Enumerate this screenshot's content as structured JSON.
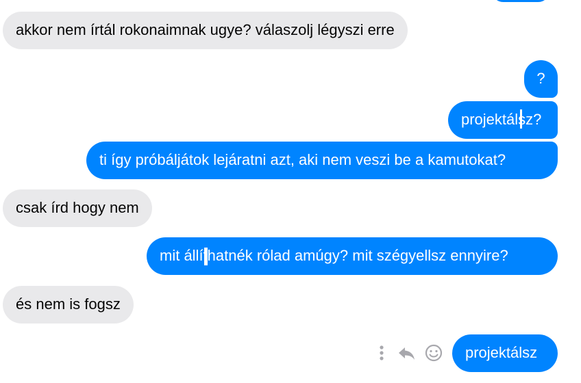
{
  "chat": {
    "messages": [
      {
        "side": "in",
        "text": "akkor nem írtál rokonaimnak ugye? válaszolj légyszi erre"
      },
      {
        "side": "out",
        "text": "?"
      },
      {
        "side": "out",
        "text": "projektálsz?"
      },
      {
        "side": "out",
        "text": "ti így próbáljátok lejáratni azt, aki nem veszi be a kamutokat?"
      },
      {
        "side": "in",
        "text": "csak írd hogy nem"
      },
      {
        "side": "out",
        "text": "mit állíthatnék rólad amúgy? mit szégyellsz ennyire?"
      },
      {
        "side": "in",
        "text": "és nem is fogsz"
      },
      {
        "side": "out",
        "text": "projektálsz"
      }
    ]
  },
  "message_actions": {
    "icons": [
      "more-vertical-icon",
      "reply-icon",
      "react-emoji-icon"
    ]
  },
  "colors": {
    "outgoing_bubble": "#0084ff",
    "incoming_bubble": "#e9e9eb",
    "icon_gray": "#a8a8ad"
  }
}
